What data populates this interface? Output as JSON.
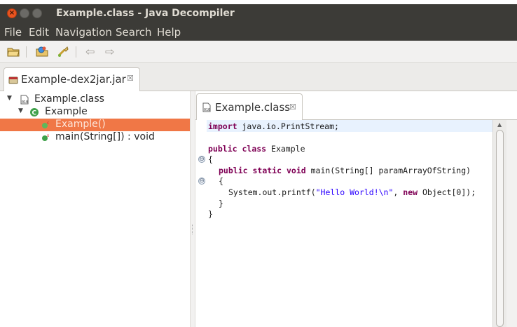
{
  "window": {
    "title": "Example.class - Java Decompiler",
    "close_glyph": "×"
  },
  "menu": [
    "File",
    "Edit",
    "Navigation",
    "Search",
    "Help"
  ],
  "toolbar": {
    "icons": [
      "open-file-icon",
      "open-type-icon",
      "search-icon",
      "back-arrow-icon",
      "forward-arrow-icon"
    ],
    "back_glyph": "⇦",
    "forward_glyph": "⇨"
  },
  "outer_tab": {
    "label": "Example-dex2jar.jar",
    "close": "☒"
  },
  "tree": [
    {
      "label": "Example.class",
      "arrow": "▼",
      "icon": "class-file-icon"
    },
    {
      "label": "Example",
      "arrow": "▼",
      "icon": "class-icon"
    },
    {
      "label": "Example()",
      "icon": "constructor-icon",
      "selected": true
    },
    {
      "label": "main(String[]) : void",
      "icon": "static-method-icon"
    }
  ],
  "inner_tab": {
    "label": "Example.class",
    "close": "☒"
  },
  "code": {
    "line1": {
      "kw": "import",
      "rest": " java.io.PrintStream;"
    },
    "line3": {
      "kw1": "public",
      "kw2": "class",
      "rest": " Example"
    },
    "line4": "{",
    "line5": {
      "kw1": "public",
      "kw2": "static",
      "kw3": "void",
      "rest": " main(String[] paramArrayOfString)"
    },
    "line6": "{",
    "line7": {
      "pre": "System.out.printf(",
      "str": "\"Hello World!\\n\"",
      "mid": ", ",
      "kw": "new",
      "post": " Object[0]);"
    },
    "line8": "}",
    "line9": "}",
    "fold_glyph": "⊖"
  },
  "colors": {
    "titlebar": "#3c3b37",
    "selection": "#f07746",
    "keyword": "#7f0055",
    "string": "#2a00ff"
  }
}
